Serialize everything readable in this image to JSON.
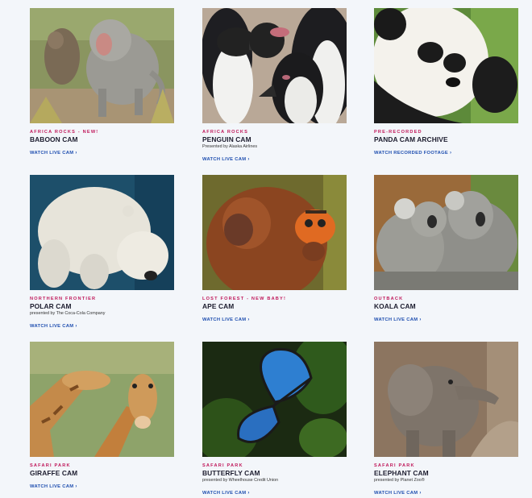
{
  "cams": [
    {
      "kicker": "Africa Rocks - New!",
      "title": "BABOON CAM",
      "sponsor": "",
      "link": "Watch Live Cam",
      "image": "baboon-photo"
    },
    {
      "kicker": "Africa Rocks",
      "title": "PENGUIN CAM",
      "sponsor": "Presented by Alaska Airlines",
      "link": "Watch Live Cam",
      "image": "penguin-photo"
    },
    {
      "kicker": "Pre-Recorded",
      "title": "PANDA CAM ARCHIVE",
      "sponsor": "",
      "link": "Watch Recorded Footage",
      "image": "panda-photo"
    },
    {
      "kicker": "Northern Frontier",
      "title": "POLAR CAM",
      "sponsor": "presented by The Coca-Cola Company",
      "link": "Watch Live Cam",
      "image": "polar-bear-photo"
    },
    {
      "kicker": "Lost Forest - New Baby!",
      "title": "APE CAM",
      "sponsor": "",
      "link": "Watch Live Cam",
      "image": "orangutan-photo"
    },
    {
      "kicker": "Outback",
      "title": "KOALA CAM",
      "sponsor": "",
      "link": "Watch Live Cam",
      "image": "koala-photo"
    },
    {
      "kicker": "Safari Park",
      "title": "GIRAFFE CAM",
      "sponsor": "",
      "link": "Watch Live Cam",
      "image": "giraffe-photo"
    },
    {
      "kicker": "Safari Park",
      "title": "BUTTERFLY CAM",
      "sponsor": "presented by Wheelhouse Credit Union",
      "link": "Watch Live Cam",
      "image": "butterfly-photo"
    },
    {
      "kicker": "Safari Park",
      "title": "ELEPHANT CAM",
      "sponsor": "presented by Planet Zoo®",
      "link": "Watch Live Cam",
      "image": "elephant-photo"
    }
  ],
  "colors": {
    "kicker": "#c0185a",
    "link": "#1f4fb0",
    "title": "#1c1c2e",
    "background": "#f3f6fa"
  },
  "link_icon": "chevron-right-icon"
}
